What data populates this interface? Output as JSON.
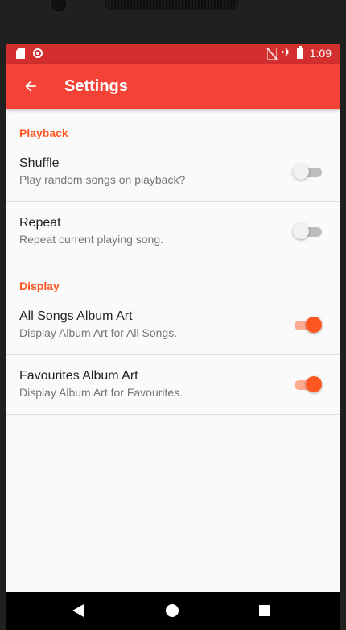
{
  "status_bar": {
    "time": "1:09",
    "left_icons": [
      "sd-card-icon",
      "record-icon"
    ],
    "right_icons": [
      "no-sim-icon",
      "airplane-mode-icon",
      "battery-icon"
    ]
  },
  "app_bar": {
    "title": "Settings",
    "back_icon": "arrow-back-icon"
  },
  "categories": [
    {
      "title": "Playback",
      "items": [
        {
          "title": "Shuffle",
          "summary": "Play random songs on playback?",
          "checked": false
        },
        {
          "title": "Repeat",
          "summary": "Repeat current playing song.",
          "checked": false
        }
      ]
    },
    {
      "title": "Display",
      "items": [
        {
          "title": "All Songs Album Art",
          "summary": "Display Album Art for All Songs.",
          "checked": true
        },
        {
          "title": "Favourites Album Art",
          "summary": "Display Album Art for Favourites.",
          "checked": true
        }
      ]
    }
  ],
  "nav_bar": {
    "icons": [
      "nav-back-icon",
      "nav-home-icon",
      "nav-recents-icon"
    ]
  },
  "colors": {
    "status_bar": "#d32f2f",
    "app_bar": "#f44336",
    "accent": "#ff5722",
    "switch_on_track": "#ffab91",
    "switch_off_track": "#bdbdbd",
    "background": "#fafafa"
  }
}
